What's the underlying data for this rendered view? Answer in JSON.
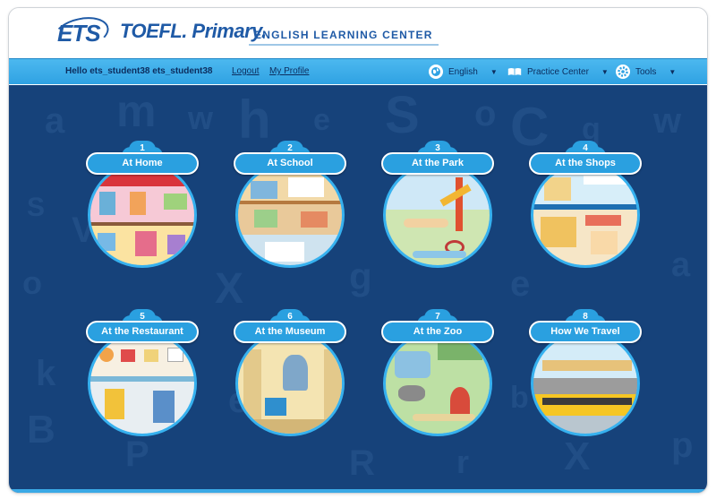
{
  "header": {
    "logo_text": "ETS",
    "brand": "TOEFL. Primary.",
    "subtitle": "ENGLISH LEARNING CENTER"
  },
  "nav": {
    "greeting": "Hello ets_student38 ets_student38",
    "logout": "Logout",
    "profile": "My Profile",
    "language": "English",
    "practice": "Practice Center",
    "tools": "Tools"
  },
  "icons": {
    "language": "globe-icon",
    "practice": "book-icon",
    "tools": "gear-icon"
  },
  "colors": {
    "brand": "#1f5aa6",
    "nav_bar": "#2fa2e3",
    "board": "#16427a",
    "card_accent": "#2aa0e0"
  },
  "units": [
    {
      "number": "1",
      "title": "At Home"
    },
    {
      "number": "2",
      "title": "At School"
    },
    {
      "number": "3",
      "title": "At the Park"
    },
    {
      "number": "4",
      "title": "At the Shops"
    },
    {
      "number": "5",
      "title": "At the Restaurant"
    },
    {
      "number": "6",
      "title": "At the Museum"
    },
    {
      "number": "7",
      "title": "At the Zoo"
    },
    {
      "number": "8",
      "title": "How We Travel"
    }
  ]
}
